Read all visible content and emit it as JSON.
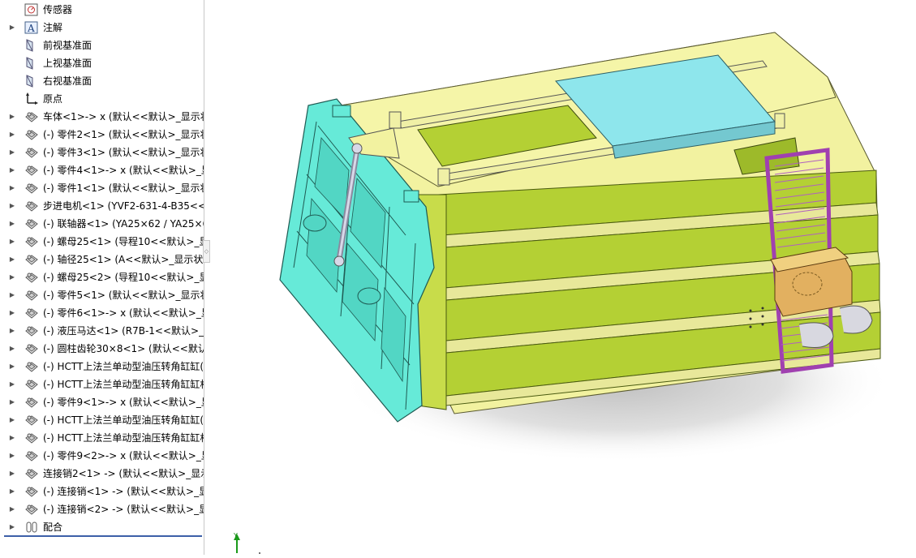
{
  "feature_tree": {
    "items": [
      {
        "label": "传感器",
        "icon": "sensor-icon",
        "expandable": false
      },
      {
        "label": "注解",
        "icon": "annotation-icon",
        "expandable": true
      },
      {
        "label": "前视基准面",
        "icon": "plane-icon",
        "expandable": false
      },
      {
        "label": "上视基准面",
        "icon": "plane-icon",
        "expandable": false
      },
      {
        "label": "右视基准面",
        "icon": "plane-icon",
        "expandable": false
      },
      {
        "label": "原点",
        "icon": "origin-icon",
        "expandable": false
      },
      {
        "label": "车体<1>-> x (默认<<默认>_显示状",
        "icon": "part-icon",
        "expandable": true
      },
      {
        "label": "(-) 零件2<1> (默认<<默认>_显示状",
        "icon": "part-icon",
        "expandable": true
      },
      {
        "label": "(-) 零件3<1> (默认<<默认>_显示状",
        "icon": "part-icon",
        "expandable": true
      },
      {
        "label": "(-) 零件4<1>-> x (默认<<默认>_显",
        "icon": "part-icon",
        "expandable": true
      },
      {
        "label": "(-) 零件1<1> (默认<<默认>_显示状",
        "icon": "part-icon",
        "expandable": true
      },
      {
        "label": "步进电机<1> (YVF2-631-4-B35<<默",
        "icon": "part-icon",
        "expandable": true
      },
      {
        "label": "(-) 联轴器<1> (YA25×62 / YA25×6",
        "icon": "part-icon",
        "expandable": true
      },
      {
        "label": "(-) 螺母25<1> (导程10<<默认>_显:",
        "icon": "part-icon",
        "expandable": true
      },
      {
        "label": "(-) 轴径25<1> (A<<默认>_显示状态",
        "icon": "part-icon",
        "expandable": true
      },
      {
        "label": "(-) 螺母25<2> (导程10<<默认>_显:",
        "icon": "part-icon",
        "expandable": true
      },
      {
        "label": "(-) 零件5<1> (默认<<默认>_显示状",
        "icon": "part-icon",
        "expandable": true
      },
      {
        "label": "(-) 零件6<1>-> x (默认<<默认>_显",
        "icon": "part-icon",
        "expandable": true
      },
      {
        "label": "(-) 液压马达<1> (R7B-1<<默认>_显",
        "icon": "part-icon",
        "expandable": true
      },
      {
        "label": "(-) 圆柱齿轮30×8<1> (默认<<默认",
        "icon": "part-icon",
        "expandable": true
      },
      {
        "label": "(-) HCTT上法兰单动型油压转角缸缸(",
        "icon": "part-icon",
        "expandable": true
      },
      {
        "label": "(-) HCTT上法兰单动型油压转角缸缸杆",
        "icon": "part-icon",
        "expandable": true
      },
      {
        "label": "(-) 零件9<1>-> x (默认<<默认>_显",
        "icon": "part-icon",
        "expandable": true
      },
      {
        "label": "(-) HCTT上法兰单动型油压转角缸缸(",
        "icon": "part-icon",
        "expandable": true
      },
      {
        "label": "(-) HCTT上法兰单动型油压转角缸缸杆",
        "icon": "part-icon",
        "expandable": true
      },
      {
        "label": "(-) 零件9<2>-> x (默认<<默认>_显",
        "icon": "part-icon",
        "expandable": true
      },
      {
        "label": "连接销2<1> -> (默认<<默认>_显示",
        "icon": "part-icon",
        "expandable": true
      },
      {
        "label": "(-) 连接销<1> -> (默认<<默认>_显",
        "icon": "part-icon",
        "expandable": true
      },
      {
        "label": "(-) 连接销<2> -> (默认<<默认>_显",
        "icon": "part-icon",
        "expandable": true
      },
      {
        "label": "配合",
        "icon": "mates-icon",
        "expandable": true
      }
    ]
  },
  "viewport": {
    "triad_axis_label": "Y",
    "colors": {
      "body_yellow": "#f2f2a0",
      "body_green": "#b4d034",
      "door_cyan": "#66ead8",
      "lid_cyan": "#8ee6ec",
      "ladder_purple": "#d070d8",
      "motor_tan": "#e2b060"
    }
  }
}
